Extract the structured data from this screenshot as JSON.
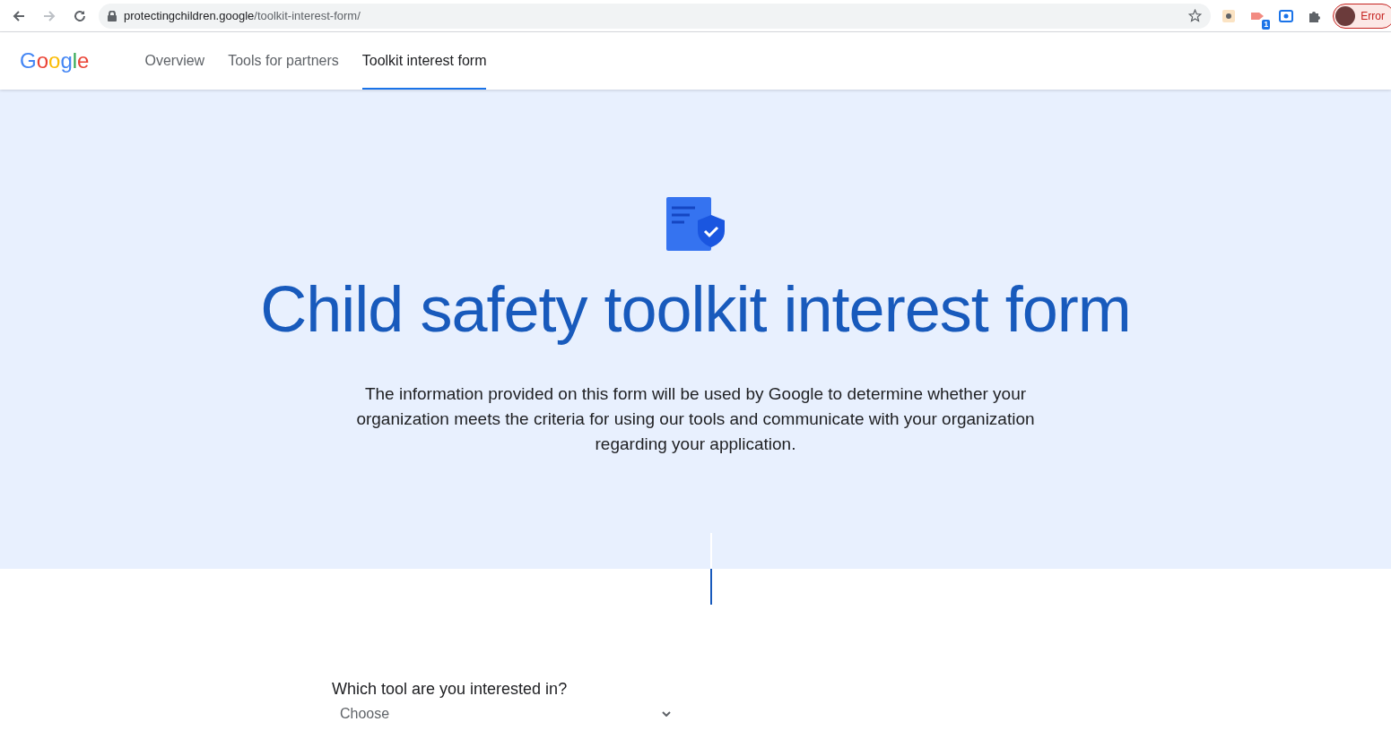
{
  "browser": {
    "url_host": "protectingchildren.google",
    "url_path": "/toolkit-interest-form/",
    "extension_badge": "1",
    "profile_label": "Error"
  },
  "site_nav": {
    "logo": "Google",
    "tabs": [
      {
        "label": "Overview",
        "selected": false
      },
      {
        "label": "Tools for partners",
        "selected": false
      },
      {
        "label": "Toolkit interest form",
        "selected": true
      }
    ]
  },
  "hero": {
    "title": "Child safety toolkit interest form",
    "description": "The information provided on this form will be used by Google to determine whether your organization meets the criteria for using our tools and communicate with your organization regarding your application."
  },
  "form": {
    "question": "Which tool are you interested in?",
    "select_placeholder": "Choose"
  }
}
